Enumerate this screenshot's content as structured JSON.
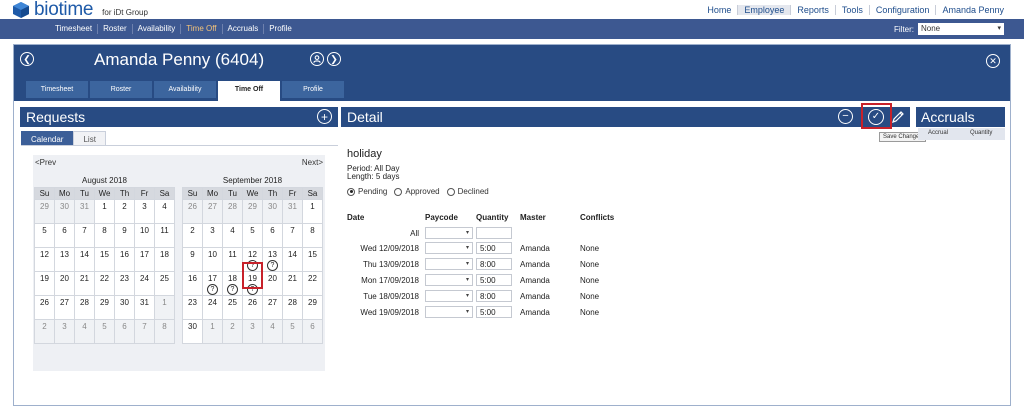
{
  "brand": {
    "name": "biotime",
    "sub": "for iDt Group",
    "color": "#1e5aa8"
  },
  "topnav": [
    "Home",
    "Employee",
    "Reports",
    "Tools",
    "Configuration",
    "Amanda Penny"
  ],
  "subnav": {
    "items": [
      "Timesheet",
      "Roster",
      "Availability",
      "Time Off",
      "Accruals",
      "Profile"
    ],
    "active": "Time Off"
  },
  "filter": {
    "label": "Filter:",
    "value": "None"
  },
  "employee": {
    "name": "Amanda Penny (6404)"
  },
  "emp_tabs": [
    "Timesheet",
    "Roster",
    "Availability",
    "Time Off",
    "Profile"
  ],
  "requests": {
    "title": "Requests",
    "view_tabs": [
      "Calendar",
      "List"
    ],
    "prev": "<Prev",
    "next": "Next>",
    "weekdays": [
      "Su",
      "Mo",
      "Tu",
      "We",
      "Th",
      "Fr",
      "Sa"
    ],
    "months": [
      {
        "title": "August 2018",
        "weeks": [
          [
            [
              "29",
              1
            ],
            [
              "30",
              1
            ],
            [
              "31",
              1
            ],
            [
              "1",
              0
            ],
            [
              "2",
              0
            ],
            [
              "3",
              0
            ],
            [
              "4",
              0
            ]
          ],
          [
            [
              "5",
              0
            ],
            [
              "6",
              0
            ],
            [
              "7",
              0
            ],
            [
              "8",
              0
            ],
            [
              "9",
              0
            ],
            [
              "10",
              0
            ],
            [
              "11",
              0
            ]
          ],
          [
            [
              "12",
              0
            ],
            [
              "13",
              0
            ],
            [
              "14",
              0
            ],
            [
              "15",
              0
            ],
            [
              "16",
              0
            ],
            [
              "17",
              0
            ],
            [
              "18",
              0
            ]
          ],
          [
            [
              "19",
              0
            ],
            [
              "20",
              0
            ],
            [
              "21",
              0
            ],
            [
              "22",
              0
            ],
            [
              "23",
              0
            ],
            [
              "24",
              0
            ],
            [
              "25",
              0
            ]
          ],
          [
            [
              "26",
              0
            ],
            [
              "27",
              0
            ],
            [
              "28",
              0
            ],
            [
              "29",
              0
            ],
            [
              "30",
              0
            ],
            [
              "31",
              0
            ],
            [
              "1",
              1
            ]
          ],
          [
            [
              "2",
              1
            ],
            [
              "3",
              1
            ],
            [
              "4",
              1
            ],
            [
              "5",
              1
            ],
            [
              "6",
              1
            ],
            [
              "7",
              1
            ],
            [
              "8",
              1
            ]
          ]
        ]
      },
      {
        "title": "September 2018",
        "weeks": [
          [
            [
              "26",
              1
            ],
            [
              "27",
              1
            ],
            [
              "28",
              1
            ],
            [
              "29",
              1
            ],
            [
              "30",
              1
            ],
            [
              "31",
              1
            ],
            [
              "1",
              0
            ]
          ],
          [
            [
              "2",
              0
            ],
            [
              "3",
              0
            ],
            [
              "4",
              0
            ],
            [
              "5",
              0
            ],
            [
              "6",
              0
            ],
            [
              "7",
              0
            ],
            [
              "8",
              0
            ]
          ],
          [
            [
              "9",
              0
            ],
            [
              "10",
              0
            ],
            [
              "11",
              0
            ],
            [
              "12",
              0,
              "?"
            ],
            [
              "13",
              0,
              "?"
            ],
            [
              "14",
              0
            ],
            [
              "15",
              0
            ]
          ],
          [
            [
              "16",
              0
            ],
            [
              "17",
              0,
              "?"
            ],
            [
              "18",
              0,
              "?"
            ],
            [
              "19",
              0,
              "?"
            ],
            [
              "20",
              0
            ],
            [
              "21",
              0
            ],
            [
              "22",
              0
            ]
          ],
          [
            [
              "23",
              0
            ],
            [
              "24",
              0
            ],
            [
              "25",
              0
            ],
            [
              "26",
              0
            ],
            [
              "27",
              0
            ],
            [
              "28",
              0
            ],
            [
              "29",
              0
            ]
          ],
          [
            [
              "30",
              0
            ],
            [
              "1",
              1
            ],
            [
              "2",
              1
            ],
            [
              "3",
              1
            ],
            [
              "4",
              1
            ],
            [
              "5",
              1
            ],
            [
              "6",
              1
            ]
          ]
        ]
      }
    ]
  },
  "detail": {
    "title": "Detail",
    "type": "holiday",
    "period": "Period:  All Day",
    "length": "Length: 5 days",
    "statuses": [
      {
        "label": "Pending",
        "checked": true
      },
      {
        "label": "Approved",
        "checked": false
      },
      {
        "label": "Declined",
        "checked": false
      }
    ],
    "columns": {
      "date": "Date",
      "paycode": "Paycode",
      "quantity": "Quantity",
      "master": "Master",
      "conflicts": "Conflicts"
    },
    "all_label": "All",
    "rows": [
      {
        "date": "Wed 12/09/2018",
        "quantity": "5:00",
        "master": "Amanda",
        "conflicts": "None"
      },
      {
        "date": "Thu 13/09/2018",
        "quantity": "8:00",
        "master": "Amanda",
        "conflicts": "None"
      },
      {
        "date": "Mon 17/09/2018",
        "quantity": "5:00",
        "master": "Amanda",
        "conflicts": "None"
      },
      {
        "date": "Tue 18/09/2018",
        "quantity": "8:00",
        "master": "Amanda",
        "conflicts": "None"
      },
      {
        "date": "Wed 19/09/2018",
        "quantity": "5:00",
        "master": "Amanda",
        "conflicts": "None"
      }
    ],
    "tooltip": "Save Changes"
  },
  "accruals": {
    "title": "Accruals",
    "col1": "Accrual",
    "col2": "Quantity"
  },
  "colors": {
    "header": "#284b83",
    "subnav": "#3d5891",
    "highlight": "#c7212a",
    "active_nav": "#f4c37a"
  }
}
